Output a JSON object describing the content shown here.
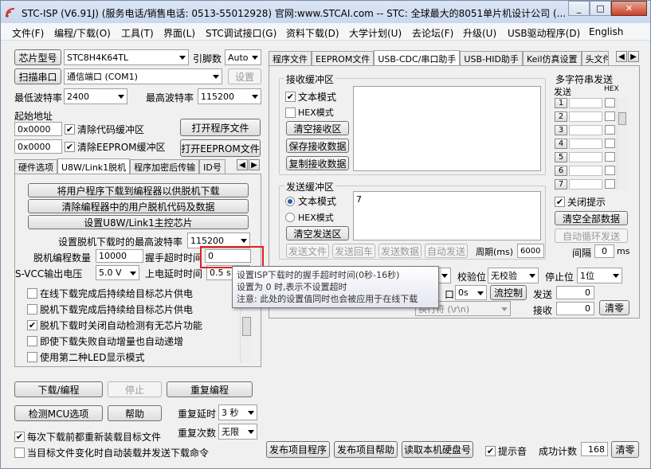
{
  "window": {
    "title": "STC-ISP (V6.91J) (服务电话/销售电话: 0513-55012928) 官网:www.STCAI.com  -- STC: 全球最大的8051单片机设计公司 (..."
  },
  "menu": [
    "文件(F)",
    "编程/下载(O)",
    "工具(T)",
    "界面(L)",
    "STC调试接口(G)",
    "资料下载(D)",
    "大学计划(U)",
    "去论坛(F)",
    "升级(U)",
    "USB驱动程序(D)",
    "English"
  ],
  "left": {
    "chip_model_btn": "芯片型号",
    "chip_model": "STC8H4K64TL",
    "pins_label": "引脚数",
    "pins": "Auto",
    "scan_port_btn": "扫描串口",
    "port": "通信端口 (COM1)",
    "settings_btn": "设置",
    "min_baud_label": "最低波特率",
    "min_baud": "2400",
    "max_baud_label": "最高波特率",
    "max_baud": "115200",
    "start_addr_label": "起始地址",
    "addr1": "0x0000",
    "clear_code_label": "清除代码缓冲区",
    "open_prog_btn": "打开程序文件",
    "addr2": "0x0000",
    "clear_eeprom_label": "清除EEPROM缓冲区",
    "open_eeprom_btn": "打开EEPROM文件",
    "tabs": [
      "硬件选项",
      "U8W/Link1脱机",
      "程序加密后传输",
      "ID号"
    ],
    "offline": {
      "btn1": "将用户程序下载到编程器以供脱机下载",
      "btn2": "清除编程器中的用户脱机代码及数据",
      "btn3": "设置U8W/Link1主控芯片",
      "max_baud_label": "设置脱机下载时的最高波特率",
      "max_baud": "115200",
      "count_label": "脱机编程数量",
      "count": "10000",
      "handshake_label": "握手超时时间",
      "handshake": "0",
      "vcc_label": "S-VCC输出电压",
      "vcc": "5.0 V",
      "power_delay_label": "上电延时时间",
      "power_delay": "0.5 s",
      "checks": [
        {
          "label": "在线下载完成后持续给目标芯片供电",
          "checked": false
        },
        {
          "label": "脱机下载完成后持续给目标芯片供电",
          "checked": false
        },
        {
          "label": "脱机下载时关闭自动检测有无芯片功能",
          "checked": true
        },
        {
          "label": "即使下载失败自动增量也自动递增",
          "checked": false
        },
        {
          "label": "使用第二种LED显示模式",
          "checked": false
        }
      ]
    },
    "download_btn": "下载/编程",
    "stop_btn": "停止",
    "reprogram_btn": "重复编程",
    "check_mcu_btn": "检测MCU选项",
    "help_btn": "帮助",
    "repeat_delay_label": "重复延时",
    "repeat_delay": "3 秒",
    "repeat_count_label": "重复次数",
    "repeat_count": "无限",
    "reload_label": "每次下载前都重新装载目标文件",
    "auto_load_label": "当目标文件变化时自动装载并发送下载命令"
  },
  "right": {
    "tabs": [
      "程序文件",
      "EEPROM文件",
      "USB-CDC/串口助手",
      "USB-HID助手",
      "Keil仿真设置",
      "头文件"
    ],
    "recv": {
      "title": "接收缓冲区",
      "text_mode": "文本模式",
      "hex_mode": "HEX模式",
      "clear_btn": "清空接收区",
      "save_btn": "保存接收数据",
      "copy_btn": "复制接收数据"
    },
    "send": {
      "title": "发送缓冲区",
      "text_mode": "文本模式",
      "hex_mode": "HEX模式",
      "clear_btn": "清空发送区",
      "content": "7",
      "send_file_btn": "发送文件",
      "send_enter_btn": "发送回车",
      "send_data_btn": "发送数据",
      "auto_send_btn": "自动发送",
      "period_label": "周期(ms)",
      "period": "6000"
    },
    "multi": {
      "title": "多字符串发送",
      "send_col": "发送",
      "hex_col": "HEX",
      "rows": [
        "1",
        "2",
        "3",
        "4",
        "5",
        "6",
        "7"
      ],
      "close_hint": "关闭提示",
      "clear_all_btn": "清空全部数据",
      "auto_loop_btn": "自动循环发送",
      "interval_label": "间隔",
      "interval": "0",
      "interval_unit": "ms"
    },
    "port_row": {
      "parity_label": "校验位",
      "parity": "无校验",
      "stop_label": "停止位",
      "stop": "1位"
    },
    "row2": {
      "port_label": "口",
      "port_val": "0s",
      "flow_btn": "流控制",
      "send_label": "发送",
      "send_count": "0"
    },
    "row3": {
      "newline": "换行符 (\\r\\n)",
      "recv_label": "接收",
      "recv_count": "0",
      "clear_btn": "清零"
    },
    "bottom": {
      "publish_btn": "发布项目程序",
      "publish_help_btn": "发布项目帮助",
      "read_disk_btn": "读取本机硬盘号",
      "sound_label": "提示音",
      "success_label": "成功计数",
      "success_count": "168",
      "clear_btn": "清零"
    }
  },
  "tooltip": {
    "line1": "设置ISP下载时的握手超时时间(0秒-16秒)",
    "line2": "设置为 0 时,表示不设置超时",
    "line3": "注意: 此处的设置值同时也会被应用于在线下载"
  }
}
